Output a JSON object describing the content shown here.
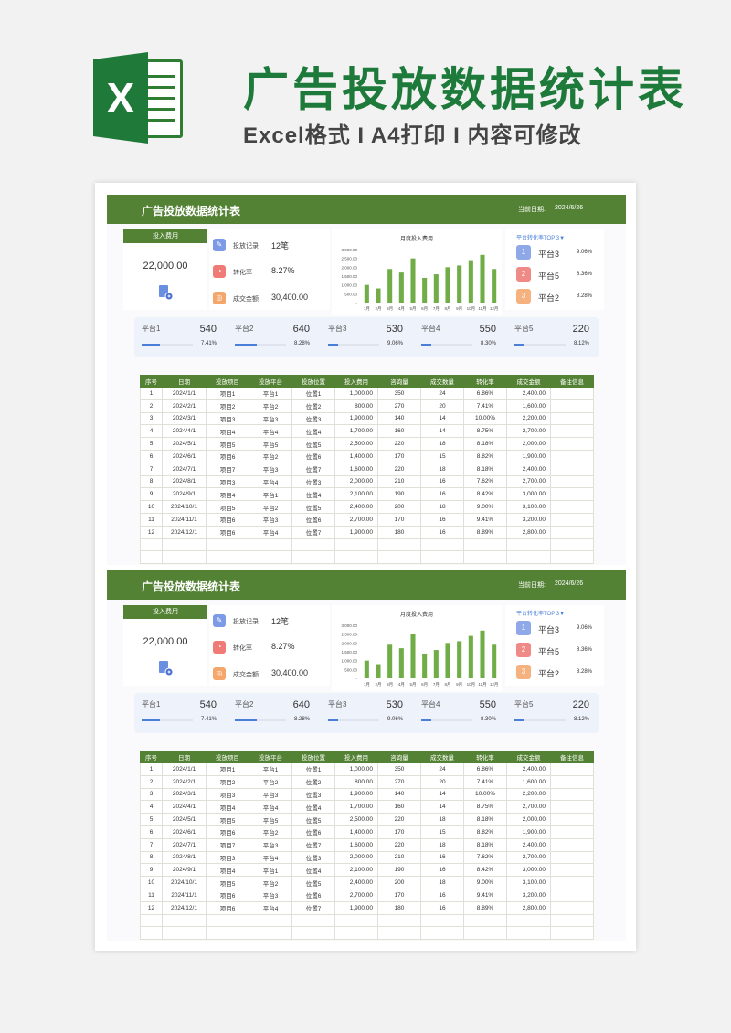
{
  "header": {
    "title": "广告投放数据统计表",
    "subtitle": "Excel格式 I A4打印 I 内容可修改",
    "logo_letter": "X"
  },
  "sheet": {
    "title": "广告投放数据统计表",
    "date_label": "当前日期:",
    "date_value": "2024/6/26",
    "kpi": {
      "label": "投入费用",
      "value": "22,000.00"
    },
    "stats": [
      {
        "icon": "note-icon",
        "label": "投放记录",
        "value": "12笔"
      },
      {
        "icon": "pie-icon",
        "label": "转化率",
        "value": "8.27%"
      },
      {
        "icon": "coin-icon",
        "label": "成交金额",
        "value": "30,400.00"
      }
    ],
    "chart_data": {
      "type": "bar",
      "title": "月度投入费用",
      "categories": [
        "1月",
        "2月",
        "3月",
        "4月",
        "5月",
        "6月",
        "7月",
        "8月",
        "9月",
        "10月",
        "11月",
        "12月"
      ],
      "values": [
        1000,
        800,
        1900,
        1700,
        2500,
        1400,
        1600,
        2000,
        2100,
        2400,
        2700,
        1900
      ],
      "y_ticks": [
        "3,000.00",
        "2,500.00",
        "2,000.00",
        "1,500.00",
        "1,000.00",
        "500.00",
        "-"
      ],
      "ylim": [
        0,
        3000
      ],
      "color": "#70ad47"
    },
    "top3": {
      "title": "平台转化率TOP 3▼",
      "items": [
        {
          "rank": "1",
          "name": "平台3",
          "rate": "9.06%",
          "color": "#8fa8e8"
        },
        {
          "rank": "2",
          "name": "平台5",
          "rate": "8.36%",
          "color": "#f08a86"
        },
        {
          "rank": "3",
          "name": "平台2",
          "rate": "8.28%",
          "color": "#f5b27f"
        }
      ]
    },
    "platforms": [
      {
        "name": "平台1",
        "value": "540",
        "pct": "7.41%",
        "fill": 0.36
      },
      {
        "name": "平台2",
        "value": "640",
        "pct": "8.28%",
        "fill": 0.42
      },
      {
        "name": "平台3",
        "value": "530",
        "pct": "9.06%",
        "fill": 0.2
      },
      {
        "name": "平台4",
        "value": "550",
        "pct": "8.30%",
        "fill": 0.2
      },
      {
        "name": "平台5",
        "value": "220",
        "pct": "8.12%",
        "fill": 0.2
      }
    ],
    "table": {
      "headers": [
        "序号",
        "日期",
        "投放项目",
        "投放平台",
        "投放位置",
        "投入费用",
        "咨询量",
        "成交数量",
        "转化率",
        "成交金额",
        "备注信息"
      ],
      "rows": [
        [
          "1",
          "2024/1/1",
          "项目1",
          "平台1",
          "位置1",
          "1,000.00",
          "350",
          "24",
          "6.86%",
          "2,400.00",
          ""
        ],
        [
          "2",
          "2024/2/1",
          "项目2",
          "平台2",
          "位置2",
          "800.00",
          "270",
          "20",
          "7.41%",
          "1,600.00",
          ""
        ],
        [
          "3",
          "2024/3/1",
          "项目3",
          "平台3",
          "位置3",
          "1,900.00",
          "140",
          "14",
          "10.00%",
          "2,200.00",
          ""
        ],
        [
          "4",
          "2024/4/1",
          "项目4",
          "平台4",
          "位置4",
          "1,700.00",
          "160",
          "14",
          "8.75%",
          "2,700.00",
          ""
        ],
        [
          "5",
          "2024/5/1",
          "项目5",
          "平台5",
          "位置5",
          "2,500.00",
          "220",
          "18",
          "8.18%",
          "2,000.00",
          ""
        ],
        [
          "6",
          "2024/6/1",
          "项目6",
          "平台2",
          "位置6",
          "1,400.00",
          "170",
          "15",
          "8.82%",
          "1,900.00",
          ""
        ],
        [
          "7",
          "2024/7/1",
          "项目7",
          "平台3",
          "位置7",
          "1,600.00",
          "220",
          "18",
          "8.18%",
          "2,400.00",
          ""
        ],
        [
          "8",
          "2024/8/1",
          "项目3",
          "平台4",
          "位置3",
          "2,000.00",
          "210",
          "16",
          "7.62%",
          "2,700.00",
          ""
        ],
        [
          "9",
          "2024/9/1",
          "项目4",
          "平台1",
          "位置4",
          "2,100.00",
          "190",
          "16",
          "8.42%",
          "3,000.00",
          ""
        ],
        [
          "10",
          "2024/10/1",
          "项目5",
          "平台2",
          "位置5",
          "2,400.00",
          "200",
          "18",
          "9.00%",
          "3,100.00",
          ""
        ],
        [
          "11",
          "2024/11/1",
          "项目6",
          "平台3",
          "位置6",
          "2,700.00",
          "170",
          "16",
          "9.41%",
          "3,200.00",
          ""
        ],
        [
          "12",
          "2024/12/1",
          "项目6",
          "平台4",
          "位置7",
          "1,900.00",
          "180",
          "16",
          "8.89%",
          "2,800.00",
          ""
        ]
      ],
      "empty_rows": 2
    }
  }
}
